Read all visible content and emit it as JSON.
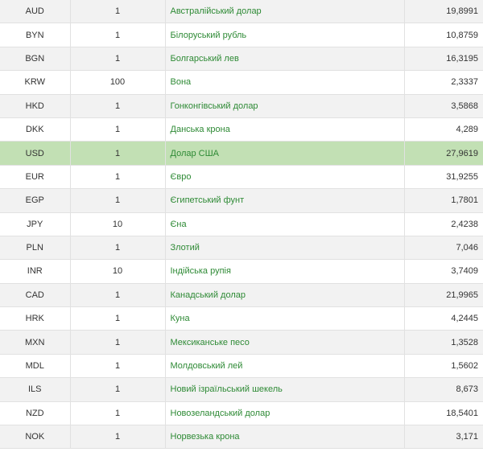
{
  "currency_table": {
    "rows": [
      {
        "code": "AUD",
        "units": "1",
        "name": "Австралійський долар",
        "rate": "19,8991"
      },
      {
        "code": "BYN",
        "units": "1",
        "name": "Білоруський рубль",
        "rate": "10,8759"
      },
      {
        "code": "BGN",
        "units": "1",
        "name": "Болгарський лев",
        "rate": "16,3195"
      },
      {
        "code": "KRW",
        "units": "100",
        "name": "Вона",
        "rate": "2,3337"
      },
      {
        "code": "HKD",
        "units": "1",
        "name": "Гонконгівський долар",
        "rate": "3,5868"
      },
      {
        "code": "DKK",
        "units": "1",
        "name": "Данська крона",
        "rate": "4,289"
      },
      {
        "code": "USD",
        "units": "1",
        "name": "Долар США",
        "rate": "27,9619"
      },
      {
        "code": "EUR",
        "units": "1",
        "name": "Євро",
        "rate": "31,9255"
      },
      {
        "code": "EGP",
        "units": "1",
        "name": "Єгипетський фунт",
        "rate": "1,7801"
      },
      {
        "code": "JPY",
        "units": "10",
        "name": "Єна",
        "rate": "2,4238"
      },
      {
        "code": "PLN",
        "units": "1",
        "name": "Злотий",
        "rate": "7,046"
      },
      {
        "code": "INR",
        "units": "10",
        "name": "Індійська рупія",
        "rate": "3,7409"
      },
      {
        "code": "CAD",
        "units": "1",
        "name": "Канадський долар",
        "rate": "21,9965"
      },
      {
        "code": "HRK",
        "units": "1",
        "name": "Куна",
        "rate": "4,2445"
      },
      {
        "code": "MXN",
        "units": "1",
        "name": "Мексиканське песо",
        "rate": "1,3528"
      },
      {
        "code": "MDL",
        "units": "1",
        "name": "Молдовський лей",
        "rate": "1,5602"
      },
      {
        "code": "ILS",
        "units": "1",
        "name": "Новий ізраїльський шекель",
        "rate": "8,673"
      },
      {
        "code": "NZD",
        "units": "1",
        "name": "Новозеландський долар",
        "rate": "18,5401"
      },
      {
        "code": "NOK",
        "units": "1",
        "name": "Норвезька крона",
        "rate": "3,171"
      }
    ],
    "highlighted_code": "USD",
    "colors": {
      "link_green": "#2e8a35",
      "highlight_bg": "#c2e0b4",
      "stripe_bg": "#f2f2f2"
    }
  }
}
